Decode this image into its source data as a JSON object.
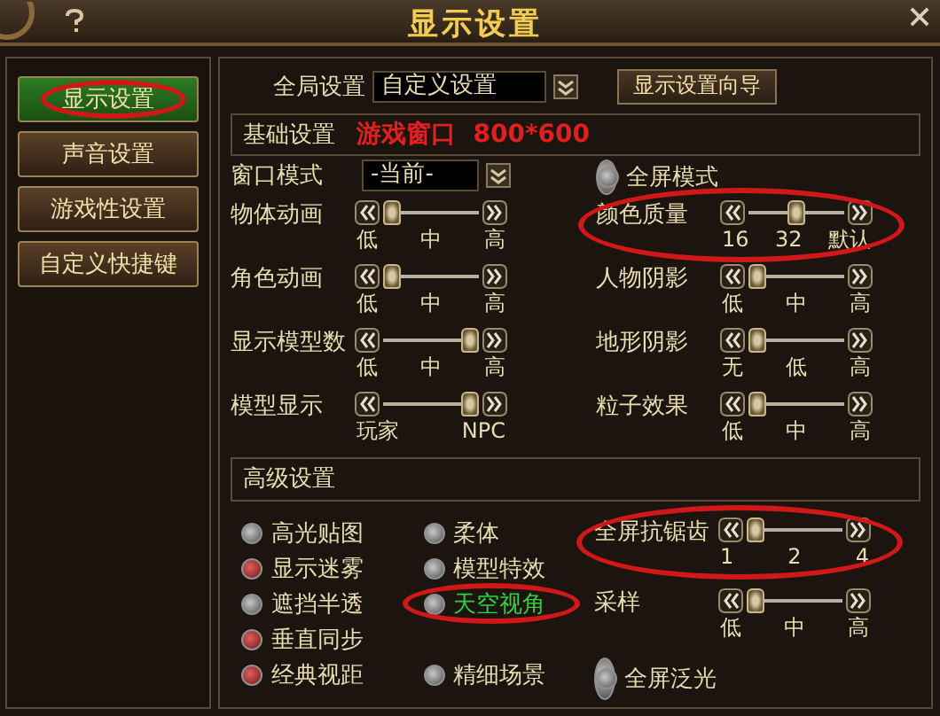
{
  "window": {
    "title": "显示设置"
  },
  "sidebar": {
    "items": [
      {
        "label": "显示设置",
        "selected": true,
        "circled": true
      },
      {
        "label": "声音设置",
        "selected": false,
        "circled": false
      },
      {
        "label": "游戏性设置",
        "selected": false,
        "circled": false
      },
      {
        "label": "自定义快捷键",
        "selected": false,
        "circled": false
      }
    ]
  },
  "global": {
    "label": "全局设置",
    "value": "自定义设置",
    "wizard_button": "显示设置向导"
  },
  "basic": {
    "title": "基础设置",
    "note": "游戏窗口  800*600",
    "rows": [
      {
        "kind": "dropdown",
        "label": "窗口模式",
        "value": "-当前-"
      },
      {
        "kind": "radio",
        "label": "全屏模式",
        "checked": false
      },
      {
        "kind": "slider",
        "label": "物体动画",
        "ticks": [
          "低",
          "中",
          "高"
        ],
        "level": 0,
        "circled": false
      },
      {
        "kind": "slider",
        "label": "颜色质量",
        "ticks": [
          "16",
          "32",
          "默认"
        ],
        "level": 0.5,
        "circled": true
      },
      {
        "kind": "slider",
        "label": "角色动画",
        "ticks": [
          "低",
          "中",
          "高"
        ],
        "level": 0,
        "circled": false
      },
      {
        "kind": "slider",
        "label": "人物阴影",
        "ticks": [
          "低",
          "中",
          "高"
        ],
        "level": 0,
        "circled": false
      },
      {
        "kind": "slider",
        "label": "显示模型数",
        "ticks": [
          "低",
          "中",
          "高"
        ],
        "level": 1,
        "circled": false
      },
      {
        "kind": "slider",
        "label": "地形阴影",
        "ticks": [
          "无",
          "低",
          "高"
        ],
        "level": 0,
        "circled": false
      },
      {
        "kind": "slider",
        "label": "模型显示",
        "ticks": [
          "玩家",
          "NPC"
        ],
        "level": 1,
        "circled": false
      },
      {
        "kind": "slider",
        "label": "粒子效果",
        "ticks": [
          "低",
          "中",
          "高"
        ],
        "level": 0,
        "circled": false
      }
    ]
  },
  "advanced": {
    "title": "高级设置",
    "option_rows": [
      [
        {
          "label": "高光贴图",
          "checked": false,
          "highlighted": false,
          "circled": false
        },
        {
          "label": "柔体",
          "checked": false,
          "highlighted": false,
          "circled": false
        }
      ],
      [
        {
          "label": "显示迷雾",
          "checked": true,
          "highlighted": false,
          "circled": false
        },
        {
          "label": "模型特效",
          "checked": false,
          "highlighted": false,
          "circled": false
        }
      ],
      [
        {
          "label": "遮挡半透",
          "checked": false,
          "highlighted": false,
          "circled": false
        },
        {
          "label": "天空视角",
          "checked": false,
          "highlighted": true,
          "circled": true
        }
      ],
      [
        {
          "label": "垂直同步",
          "checked": true,
          "highlighted": false,
          "circled": false
        }
      ],
      [
        {
          "label": "经典视距",
          "checked": true,
          "highlighted": false,
          "circled": false
        },
        {
          "label": "精细场景",
          "checked": false,
          "highlighted": false,
          "circled": false
        }
      ]
    ],
    "right": [
      {
        "kind": "slider",
        "label": "全屏抗锯齿",
        "ticks": [
          "1",
          "2",
          "4"
        ],
        "level": 0,
        "circled": true
      },
      {
        "kind": "slider",
        "label": "采样",
        "ticks": [
          "低",
          "中",
          "高"
        ],
        "level": 0,
        "circled": false
      },
      {
        "kind": "radio",
        "label": "全屏泛光",
        "checked": false
      }
    ]
  }
}
